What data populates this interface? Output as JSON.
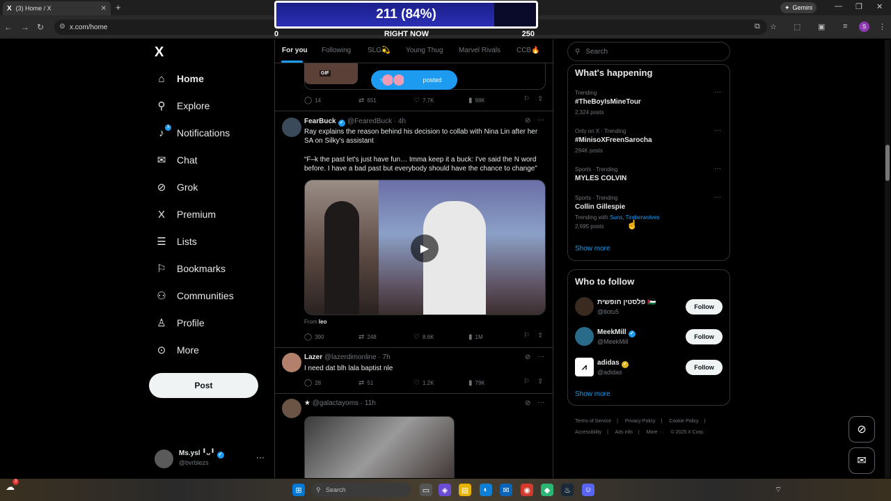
{
  "browser": {
    "tab_title": "(3) Home / X",
    "tab_logo": "X",
    "tab_close": "✕",
    "new_tab": "+",
    "url": "x.com/home",
    "gemini_label": "Gemini",
    "profile_initial": "S",
    "window_controls": [
      "—",
      "❐",
      "✕"
    ]
  },
  "overlay": {
    "value_text": "211 (84%)",
    "fill_fraction": 0.84,
    "min_label": "0",
    "center_label": "RIGHT NOW",
    "max_label": "250"
  },
  "sidebar": {
    "logo": "X",
    "items": [
      {
        "label": "Home",
        "icon": "home-icon",
        "glyph": "⌂"
      },
      {
        "label": "Explore",
        "icon": "search-icon",
        "glyph": "⚲"
      },
      {
        "label": "Notifications",
        "icon": "bell-icon",
        "glyph": "🔔︎",
        "badge": "3"
      },
      {
        "label": "Chat",
        "icon": "mail-icon",
        "glyph": "✉"
      },
      {
        "label": "Grok",
        "icon": "grok-icon",
        "glyph": "⊘"
      },
      {
        "label": "Premium",
        "icon": "x-icon",
        "glyph": "X"
      },
      {
        "label": "Lists",
        "icon": "list-icon",
        "glyph": "☰"
      },
      {
        "label": "Bookmarks",
        "icon": "bookmark-icon",
        "glyph": "⚐"
      },
      {
        "label": "Communities",
        "icon": "people-icon",
        "glyph": "⚇"
      },
      {
        "label": "Profile",
        "icon": "person-icon",
        "glyph": "♙"
      },
      {
        "label": "More",
        "icon": "more-circle-icon",
        "glyph": "⊙"
      }
    ],
    "post_label": "Post",
    "account": {
      "name": "Ms.ysl ╹ᴗ╹",
      "handle": "@bvrblezs",
      "more": "···"
    }
  },
  "feed": {
    "tabs": [
      "For you",
      "Following",
      "SLG💫",
      "Young Thug",
      "Marvel Rivals",
      "CCB🔥"
    ],
    "gif_label": "GIF",
    "posted_label": "posted",
    "tweets": [
      {
        "metrics": {
          "replies": "14",
          "reposts": "651",
          "likes": "7.7K",
          "views": "98K"
        }
      },
      {
        "name": "FearBuck",
        "handle": "@FearedBuck · 4h",
        "text1": "Ray explains the reason behind his decision to collab with Nina Lin after her SA on Silky's assistant",
        "text2": "“F–k the past let's just have fun… Imma keep it a buck: I've said the N word before. I have a bad past but everybody should have the chance to change”",
        "from_prefix": "From",
        "from_user": "leo",
        "metrics": {
          "replies": "390",
          "reposts": "248",
          "likes": "8.6K",
          "views": "1M"
        }
      },
      {
        "name": "Lazer",
        "handle": "@lazerdimonline · 7h",
        "text1": "I need dat blh lala baptist nle",
        "metrics": {
          "replies": "28",
          "reposts": "51",
          "likes": "1.2K",
          "views": "79K"
        }
      },
      {
        "handle": "@galactayoms · 11h"
      }
    ]
  },
  "right": {
    "search_placeholder": "Search",
    "happening_title": "What's happening",
    "trends": [
      {
        "context": "Trending",
        "name": "#TheBoyIsMineTour",
        "count": "2,324 posts"
      },
      {
        "context": "Only on X · Trending",
        "name": "#MinisoXFreenSarocha",
        "count": "294K posts"
      },
      {
        "context": "Sports · Trending",
        "name": "MYLES COLVIN"
      },
      {
        "context": "Sports · Trending",
        "name": "Collin Gillespie",
        "with_prefix": "Trending with",
        "with_links": "Suns, Timberwolves",
        "count": "2,695 posts"
      }
    ],
    "show_more": "Show more",
    "who_title": "Who to follow",
    "follow_label": "Follow",
    "who": [
      {
        "name": "פלסטין חופשית 🇵🇸",
        "handle": "@tlotu5"
      },
      {
        "name": "MeekMill",
        "handle": "@MeekMill"
      },
      {
        "name": "adidas",
        "handle": "@adidas"
      }
    ],
    "footer": [
      "Terms of Service",
      "|",
      "Privacy Policy",
      "|",
      "Cookie Policy",
      "|",
      "Accessibility",
      "|",
      "Ads info",
      "|",
      "More ···",
      "© 2025 X Corp."
    ]
  },
  "taskbar": {
    "search_placeholder": "Search",
    "weather_badge": "3"
  },
  "colors": {
    "accent": "#1d9bf0",
    "background": "#000000",
    "text": "#e7e9ea",
    "muted": "#71767b",
    "border": "#2f3336"
  }
}
